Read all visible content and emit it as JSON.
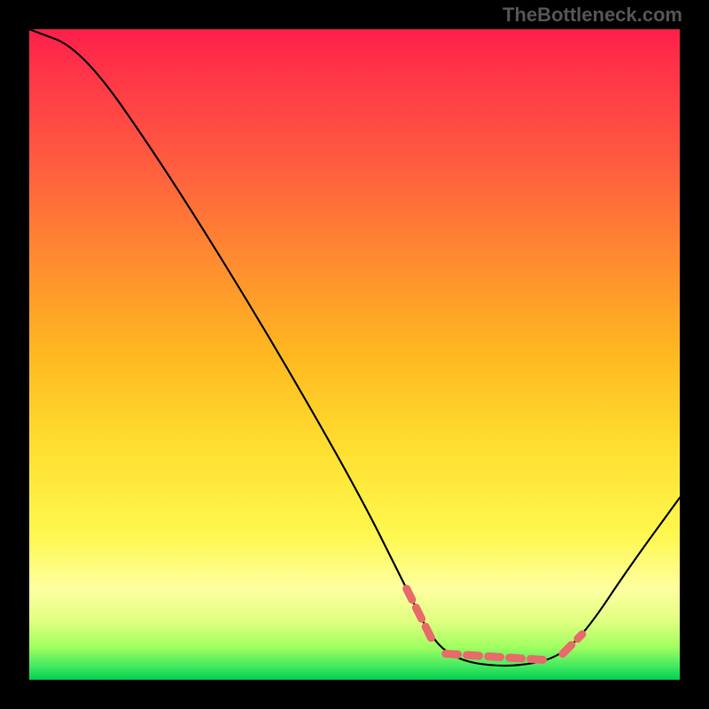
{
  "attribution": "TheBottleneck.com",
  "chart_data": {
    "type": "line",
    "title": "",
    "xlabel": "",
    "ylabel": "",
    "xlim": [
      0,
      100
    ],
    "ylim": [
      0,
      100
    ],
    "note": "V-shaped bottleneck curve over a vertical red→yellow→green gradient. Left branch descends from top-left toward a flat valley near x≈62–82, y≈2; right branch rises toward x=100, y≈28. Valley region is highlighted with salmon-colored dashed segments.",
    "series": [
      {
        "name": "bottleneck-curve",
        "points": [
          {
            "x": 0,
            "y": 100
          },
          {
            "x": 8,
            "y": 97
          },
          {
            "x": 20,
            "y": 80
          },
          {
            "x": 35,
            "y": 56
          },
          {
            "x": 50,
            "y": 30
          },
          {
            "x": 58,
            "y": 14
          },
          {
            "x": 62,
            "y": 6
          },
          {
            "x": 66,
            "y": 3
          },
          {
            "x": 72,
            "y": 2
          },
          {
            "x": 78,
            "y": 2.5
          },
          {
            "x": 82,
            "y": 4
          },
          {
            "x": 86,
            "y": 8
          },
          {
            "x": 92,
            "y": 17
          },
          {
            "x": 100,
            "y": 28
          }
        ]
      }
    ],
    "highlight_segments": [
      {
        "x1": 58,
        "y1": 14,
        "x2": 62,
        "y2": 6
      },
      {
        "x1": 64,
        "y1": 4,
        "x2": 80,
        "y2": 3
      },
      {
        "x1": 82,
        "y1": 4,
        "x2": 85,
        "y2": 7
      }
    ],
    "gradient_stops": [
      {
        "pos": 0,
        "color": "#ff1e4a"
      },
      {
        "pos": 50,
        "color": "#ffe030"
      },
      {
        "pos": 100,
        "color": "#00d050"
      }
    ]
  }
}
